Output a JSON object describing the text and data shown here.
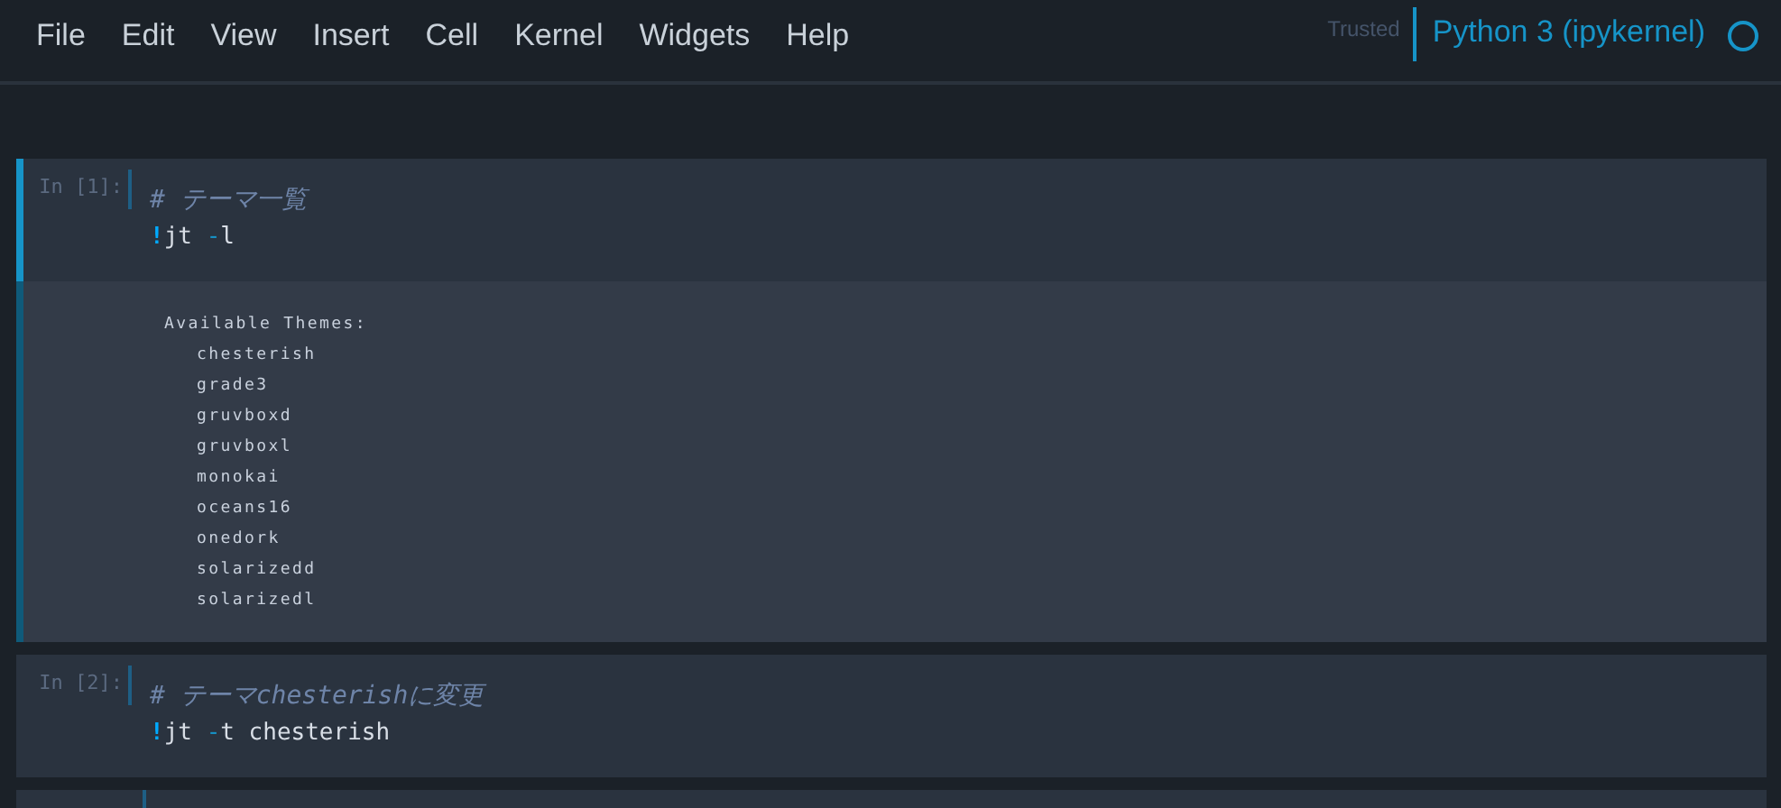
{
  "menu": {
    "items": [
      "File",
      "Edit",
      "View",
      "Insert",
      "Cell",
      "Kernel",
      "Widgets",
      "Help"
    ]
  },
  "kernel": {
    "trusted": "Trusted",
    "name": "Python 3 (ipykernel)",
    "busy": false
  },
  "cells": [
    {
      "prompt": "In [1]:",
      "selected": true,
      "comment": "# テーマ一覧",
      "code": [
        {
          "kind": "bang",
          "text": "!"
        },
        {
          "kind": "plain",
          "text": "jt "
        },
        {
          "kind": "operator",
          "text": "-"
        },
        {
          "kind": "plain",
          "text": "l"
        }
      ],
      "output": {
        "heading": "Available Themes:",
        "lines": [
          "chesterish",
          "grade3",
          "gruvboxd",
          "gruvboxl",
          "monokai",
          "oceans16",
          "onedork",
          "solarizedd",
          "solarizedl"
        ]
      }
    },
    {
      "prompt": "In [2]:",
      "selected": false,
      "comment": "# テーマchesterishに変更",
      "code": [
        {
          "kind": "bang",
          "text": "!"
        },
        {
          "kind": "plain",
          "text": "jt "
        },
        {
          "kind": "operator",
          "text": "-"
        },
        {
          "kind": "plain",
          "text": "t chesterish"
        }
      ]
    }
  ]
}
